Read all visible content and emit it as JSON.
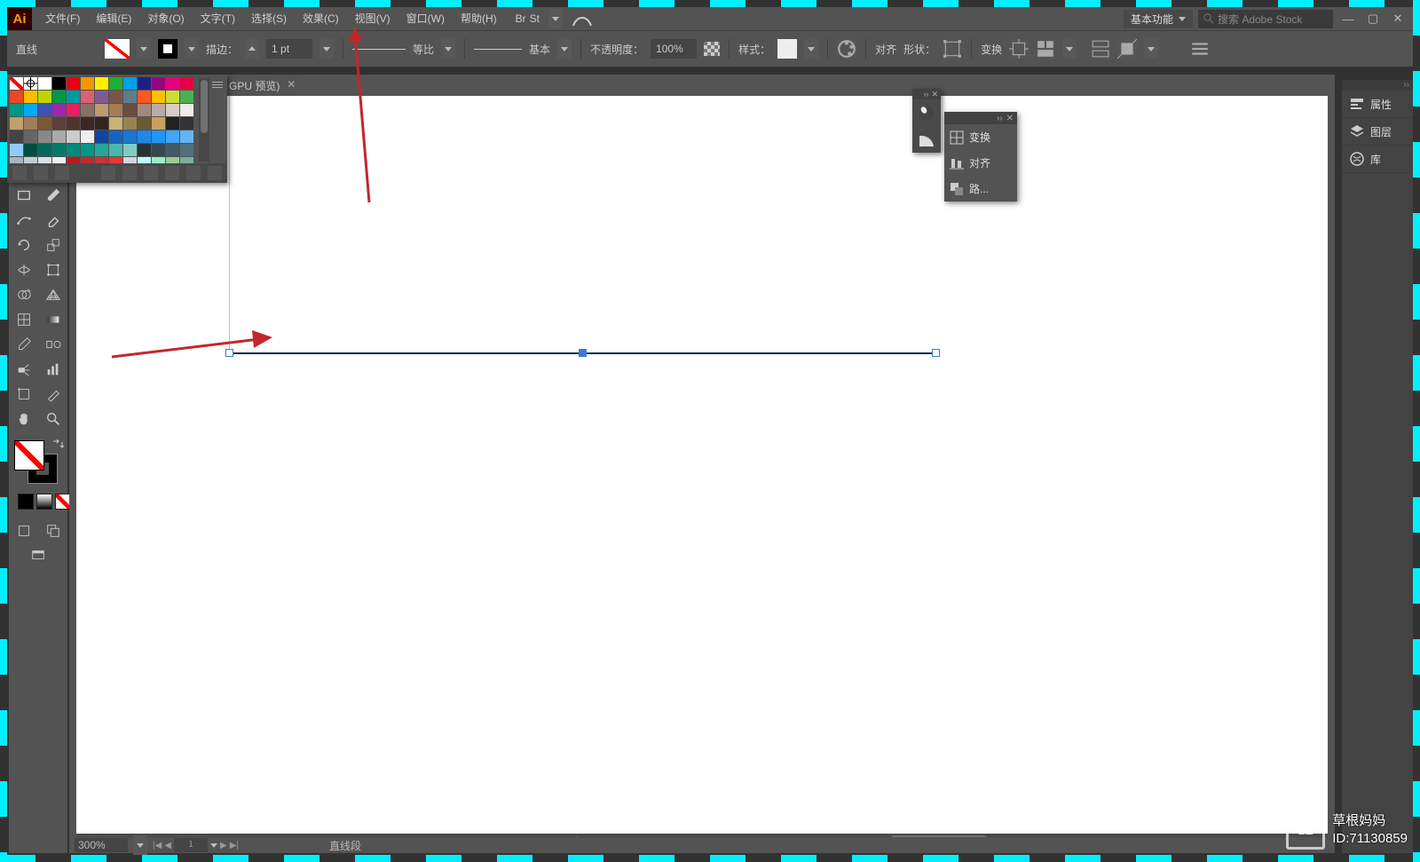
{
  "menubar": {
    "items": [
      "文件(F)",
      "编辑(E)",
      "对象(O)",
      "文字(T)",
      "选择(S)",
      "效果(C)",
      "视图(V)",
      "窗口(W)",
      "帮助(H)"
    ],
    "bridge": "Br",
    "stock": "St",
    "workspace": "基本功能",
    "search_placeholder": "搜索 Adobe Stock"
  },
  "controlbar": {
    "object_label": "直线",
    "stroke_label": "描边：",
    "stroke_weight": "1 pt",
    "dash_profile": "等比",
    "brush_profile": "基本",
    "opacity_label": "不透明度：",
    "opacity_value": "100%",
    "style_label": "样式：",
    "align_label": "对齐",
    "shape_label": "形状：",
    "transform_label": "变换"
  },
  "doc_tab": {
    "title": "GPU 预览)",
    "closable": true
  },
  "tr_panel": {
    "items": [
      "变换",
      "对齐",
      "路..."
    ]
  },
  "right_dock": {
    "items": [
      "属性",
      "图层",
      "库"
    ]
  },
  "status": {
    "zoom": "300%",
    "pages": "1",
    "tool": "直线段"
  },
  "swatch_colors": [
    "#ffffff",
    "#000000",
    "#e70012",
    "#f29700",
    "#fff000",
    "#21ac38",
    "#00a0e9",
    "#1d2087",
    "#910782",
    "#e3007f",
    "#e50045",
    "#e94829",
    "#fabe00",
    "#bdd500",
    "#009844",
    "#009b9f",
    "#da6272",
    "#815c94",
    "#795548",
    "#607d8b",
    "#ff5722",
    "#ffc107",
    "#cddc39",
    "#4caf50",
    "#009688",
    "#03a9f4",
    "#3f51b5",
    "#9c27b0",
    "#e91e63",
    "#8d6e63",
    "#bf9972",
    "#a67c52",
    "#6d4c41",
    "#a1887f",
    "#bcaaa4",
    "#d7ccc8",
    "#efebe9",
    "#c0a16b",
    "#9e7e5d",
    "#7b5835",
    "#5d4037",
    "#4e342e",
    "#3e2723",
    "#33261d",
    "#c8b273",
    "#9a8250",
    "#6a5a32",
    "#c9a063",
    "#222222",
    "#333333",
    "#444444",
    "#666666",
    "#888888",
    "#aaaaaa",
    "#cccccc",
    "#eeeeee",
    "#0d47a1",
    "#1565c0",
    "#1976d2",
    "#1e88e5",
    "#2196f3",
    "#42a5f5",
    "#64b5f6",
    "#90caf9",
    "#004d40",
    "#00695c",
    "#00796b",
    "#00897b",
    "#009688",
    "#26a69a",
    "#4db6ac",
    "#80cbc4",
    "#263238",
    "#37474f",
    "#455a64",
    "#546e7a",
    "#a5b7c0",
    "#c3ccd1",
    "#dbe0e3",
    "#f0f0f0",
    "#b71c1c",
    "#c62828",
    "#d32f2f",
    "#e53935",
    "#cfd8dc",
    "#BBFFFF",
    "#99EECC",
    "#99CC99",
    "#78b09a",
    "#6e9f7b",
    "#ffbbdd",
    "#f0b3d8",
    "#dd99ee",
    "#c797e0"
  ],
  "watermark": {
    "logo": "1E",
    "name": "草根妈妈",
    "id": "ID:71130859"
  }
}
